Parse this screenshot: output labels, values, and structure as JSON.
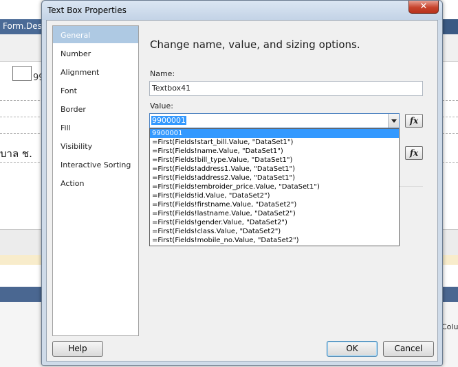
{
  "background": {
    "tab_title": "Form.Desig",
    "cell_text": "99",
    "thai_text": "บาล ช.",
    "column_text": "Colu"
  },
  "dialog": {
    "title": "Text Box Properties",
    "close_glyph": "✕",
    "nav": [
      "General",
      "Number",
      "Alignment",
      "Font",
      "Border",
      "Fill",
      "Visibility",
      "Interactive Sorting",
      "Action"
    ],
    "active_nav": "General",
    "heading": "Change name, value, and sizing options.",
    "name_label": "Name:",
    "name_value": "Textbox41",
    "value_label": "Value:",
    "value_value": "9900001",
    "fx_label": "fx",
    "dropdown_options": [
      "9900001",
      "=First(Fields!start_bill.Value, \"DataSet1\")",
      "=First(Fields!name.Value, \"DataSet1\")",
      "=First(Fields!bill_type.Value, \"DataSet1\")",
      "=First(Fields!address1.Value, \"DataSet1\")",
      "=First(Fields!address2.Value, \"DataSet1\")",
      "=First(Fields!embroider_price.Value, \"DataSet1\")",
      "=First(Fields!id.Value, \"DataSet2\")",
      "=First(Fields!firstname.Value, \"DataSet2\")",
      "=First(Fields!lastname.Value, \"DataSet2\")",
      "=First(Fields!gender.Value, \"DataSet2\")",
      "=First(Fields!class.Value, \"DataSet2\")",
      "=First(Fields!mobile_no.Value, \"DataSet2\")"
    ],
    "selected_option": "9900001",
    "help_label": "Help",
    "ok_label": "OK",
    "cancel_label": "Cancel"
  }
}
